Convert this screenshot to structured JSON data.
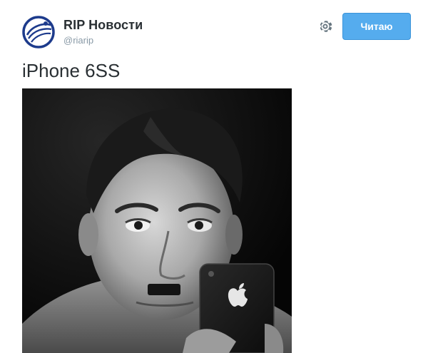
{
  "account": {
    "name": "RIP Новости",
    "handle": "@riarip"
  },
  "actions": {
    "follow_label": "Читаю",
    "settings_icon": "gear-icon"
  },
  "tweet": {
    "text": "iPhone 6SS",
    "photo_icon": "photo"
  },
  "colors": {
    "accent": "#55acee",
    "handle": "#8899a6",
    "text": "#292f33",
    "logo": "#1d3b8c"
  }
}
